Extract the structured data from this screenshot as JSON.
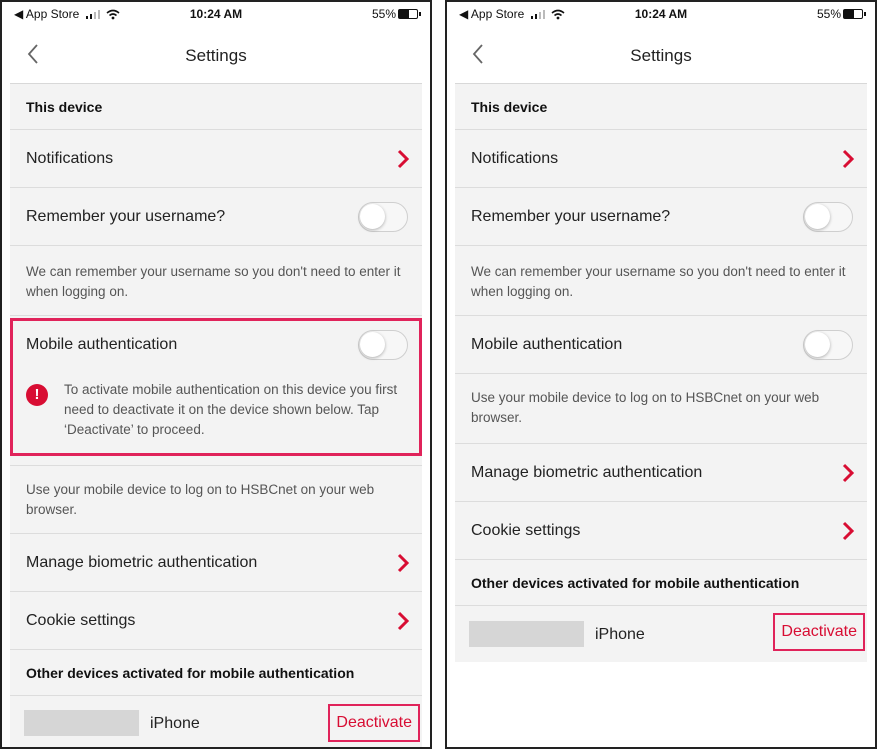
{
  "status": {
    "carrier": "◀ App Store",
    "time": "10:24 AM",
    "battery": "55%"
  },
  "header": {
    "title": "Settings"
  },
  "sections": {
    "this_device": "This device",
    "other_devices": "Other devices activated for mobile authentication"
  },
  "rows": {
    "notifications": "Notifications",
    "remember_username": "Remember your username?",
    "remember_desc": "We can remember your username so you don't need to enter it when logging on.",
    "mobile_auth": "Mobile authentication",
    "mobile_auth_warning": "To activate mobile authentication on this device you first need to deactivate it on the device shown below. Tap ‘Deactivate’ to proceed.",
    "mobile_auth_desc": "Use your mobile device to log on to HSBCnet on your web browser.",
    "biometric": "Manage biometric authentication",
    "cookies": "Cookie settings"
  },
  "device": {
    "label": "iPhone",
    "action": "Deactivate"
  },
  "toggles": {
    "remember_username": false,
    "mobile_auth": false
  },
  "colors": {
    "accent": "#d80d33",
    "highlight": "#e0235a",
    "row_bg": "#f3f3f3"
  },
  "icons": [
    "back-chevron-icon",
    "chevron-right-icon",
    "exclamation-icon",
    "signal-icon",
    "wifi-icon",
    "battery-icon"
  ]
}
